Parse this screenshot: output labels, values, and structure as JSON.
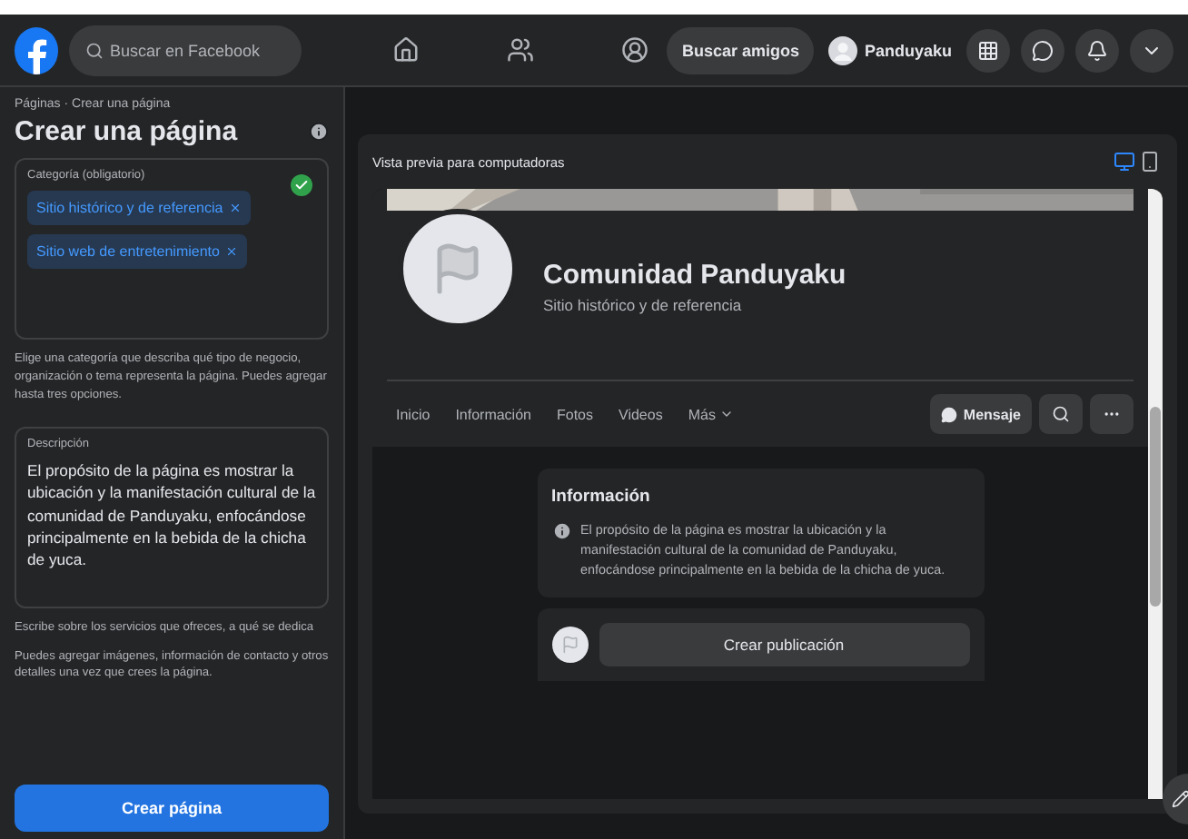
{
  "topbar": {
    "search": {
      "placeholder": "Buscar en Facebook"
    },
    "nav": [
      {
        "kind": "home"
      },
      {
        "kind": "friends"
      },
      {
        "kind": "groups"
      }
    ],
    "find_friends": "Buscar amigos",
    "profile": {
      "name": "Panduyaku"
    },
    "actions": [
      {
        "kind": "menu"
      },
      {
        "kind": "messenger"
      },
      {
        "kind": "bell"
      },
      {
        "kind": "caret"
      }
    ]
  },
  "sidebar": {
    "breadcrumb": "Páginas · Crear una página",
    "title": "Crear una página",
    "category": {
      "label": "Categoría (obligatorio)",
      "valid": true,
      "tags": [
        "Sitio histórico y de referencia",
        "Sitio web de entretenimiento"
      ]
    },
    "category_help": "Elige una categoría que describa qué tipo de negocio, organización o tema representa la página. Puedes agregar hasta tres opciones.",
    "description": {
      "label": "Descripción",
      "value": "El propósito de la página es mostrar la ubicación y la manifestación cultural de la comunidad de Panduyaku, enfocándose principalmente en la bebida de la chicha de yuca."
    },
    "description_help": "Escribe sobre los servicios que ofreces, a qué se dedica",
    "extra_help": "Puedes agregar imágenes, información de contacto y otros detalles una vez que crees la página.",
    "create_button": "Crear página"
  },
  "preview": {
    "title": "Vista previa para computadoras",
    "modes": [
      {
        "kind": "desktop",
        "selected": true
      },
      {
        "kind": "mobile",
        "selected": false
      }
    ],
    "page_name": "Comunidad Panduyaku",
    "page_category": "Sitio histórico y de referencia",
    "tabs": [
      {
        "label": "Inicio",
        "dropdown": false
      },
      {
        "label": "Información",
        "dropdown": false
      },
      {
        "label": "Fotos",
        "dropdown": false
      },
      {
        "label": "Videos",
        "dropdown": false
      },
      {
        "label": "Más",
        "dropdown": true
      }
    ],
    "message_button": "Mensaje",
    "info_card": {
      "title": "Información",
      "text": "El propósito de la página es mostrar la ubicación y la manifestación cultural de la comunidad de Panduyaku, enfocándose principalmente en la bebida de la chicha de yuca."
    },
    "create_post": "Crear publicación"
  }
}
